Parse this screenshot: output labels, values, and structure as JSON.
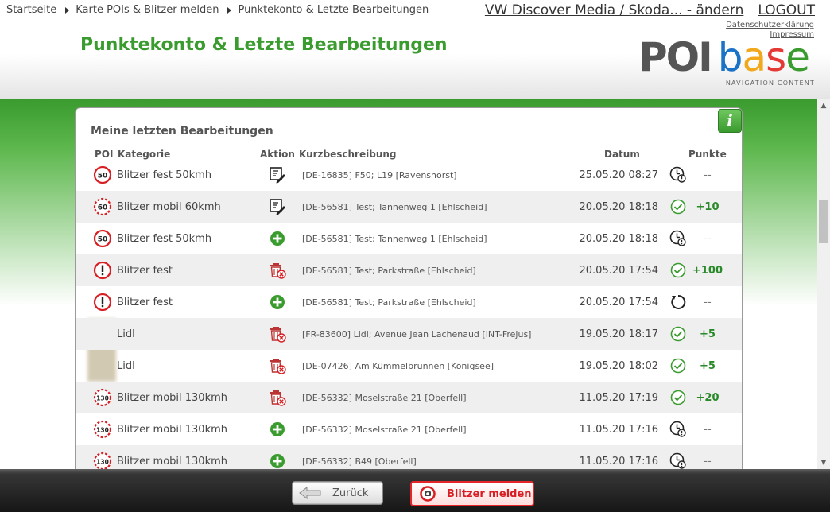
{
  "breadcrumb": [
    "Startseite",
    "Karte POIs & Blitzer melden",
    "Punktekonto & Letzte Bearbeitungen"
  ],
  "account": {
    "device": "VW Discover Media / Skoda... - ändern",
    "logout": "LOGOUT"
  },
  "links": {
    "privacy": "Datenschutzerklärung",
    "imprint": "Impressum"
  },
  "page_title": "Punktekonto & Letzte Bearbeitungen",
  "logo": {
    "poi": "POI",
    "base_letters": [
      "b",
      "a",
      "s",
      "e"
    ],
    "base_colors": [
      "#1a73c7",
      "#f2a81d",
      "#e53935",
      "#3a9b2e"
    ],
    "poi_color": "#555555",
    "subtitle": "NAVIGATION CONTENT"
  },
  "panel": {
    "title": "Meine letzten Bearbeitungen",
    "info_icon": "i",
    "columns": {
      "poi": "POI",
      "category": "Kategorie",
      "action": "Aktion",
      "description": "Kurzbeschreibung",
      "date": "Datum",
      "points": "Punkte"
    }
  },
  "rows": [
    {
      "poi_icon": "speed-50-fixed",
      "category": "Blitzer fest 50kmh",
      "action": "edit",
      "description": "[DE-16835] F50; L19 [Ravenshorst]",
      "date": "25.05.20 08:27",
      "status": "pending",
      "points": "--"
    },
    {
      "poi_icon": "speed-60-mobile",
      "category": "Blitzer mobil 60kmh",
      "action": "edit",
      "description": "[DE-56581] Test; Tannenweg 1 [Ehlscheid]",
      "date": "20.05.20 18:18",
      "status": "accepted",
      "points": "+10"
    },
    {
      "poi_icon": "speed-50-fixed",
      "category": "Blitzer fest 50kmh",
      "action": "add",
      "description": "[DE-56581] Test; Tannenweg 1 [Ehlscheid]",
      "date": "20.05.20 18:18",
      "status": "pending",
      "points": "--"
    },
    {
      "poi_icon": "warning-fixed",
      "category": "Blitzer fest",
      "action": "delete",
      "description": "[DE-56581] Test; Parkstraße [Ehlscheid]",
      "date": "20.05.20 17:54",
      "status": "accepted",
      "points": "+100"
    },
    {
      "poi_icon": "warning-fixed",
      "category": "Blitzer fest",
      "action": "add",
      "description": "[DE-56581] Test; Parkstraße [Ehlscheid]",
      "date": "20.05.20 17:54",
      "status": "reverted",
      "points": "--"
    },
    {
      "poi_icon": "blurred",
      "category": "Lidl",
      "action": "delete",
      "description": "[FR-83600] Lidl; Avenue Jean Lachenaud [INT-Frejus]",
      "date": "19.05.20 18:17",
      "status": "accepted",
      "points": "+5"
    },
    {
      "poi_icon": "blurred",
      "category": "Lidl",
      "action": "delete",
      "description": "[DE-07426] Am Kümmelbrunnen [Königsee]",
      "date": "19.05.20 18:02",
      "status": "accepted",
      "points": "+5"
    },
    {
      "poi_icon": "speed-130-mobile",
      "category": "Blitzer mobil 130kmh",
      "action": "delete",
      "description": "[DE-56332] Moselstraße 21 [Oberfell]",
      "date": "11.05.20 17:19",
      "status": "accepted",
      "points": "+20"
    },
    {
      "poi_icon": "speed-130-mobile",
      "category": "Blitzer mobil 130kmh",
      "action": "add",
      "description": "[DE-56332] Moselstraße 21 [Oberfell]",
      "date": "11.05.20 17:16",
      "status": "pending",
      "points": "--"
    },
    {
      "poi_icon": "speed-130-mobile",
      "category": "Blitzer mobil 130kmh",
      "action": "add",
      "description": "[DE-56332] B49 [Oberfell]",
      "date": "11.05.20 17:16",
      "status": "pending",
      "points": "--"
    }
  ],
  "footer": {
    "back_label": "Zurück",
    "report_label": "Blitzer melden"
  },
  "colors": {
    "green": "#3a9b2e",
    "red": "#d81e23"
  }
}
